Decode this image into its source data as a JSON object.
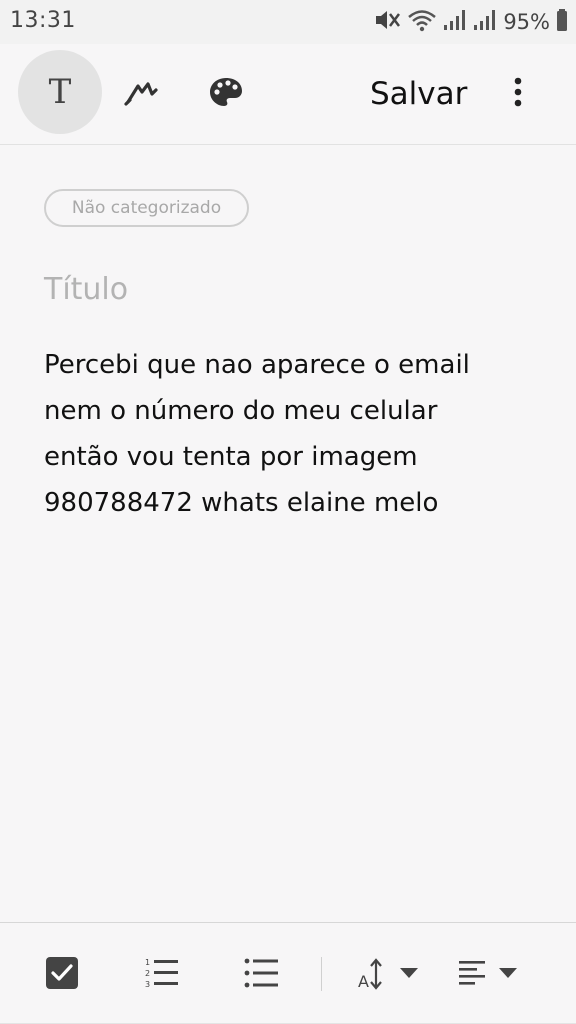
{
  "status_bar": {
    "time": "13:31",
    "battery_percent": "95%",
    "icons": [
      "mute-icon",
      "wifi-icon",
      "signal-icon",
      "signal-icon",
      "battery-icon"
    ]
  },
  "toolbar": {
    "text_mode_label": "T",
    "icons": [
      "text-mode-icon",
      "pen-icon",
      "palette-icon",
      "more-options-icon"
    ],
    "save_label": "Salvar"
  },
  "note": {
    "category": "Não categorizado",
    "title_placeholder": "Título",
    "body_lines": [
      "Percebi que nao aparece o email",
      "nem o número do meu celular",
      "então vou tenta por imagem",
      "980788472 whats elaine melo"
    ]
  },
  "bottom_toolbar": {
    "icons": [
      "checkbox-icon",
      "numbered-list-icon",
      "bullet-list-icon",
      "text-size-icon",
      "align-icon"
    ]
  },
  "colors": {
    "background": "#f7f6f7",
    "text": "#111111",
    "muted": "#b3b3b3",
    "icon": "#333333"
  }
}
